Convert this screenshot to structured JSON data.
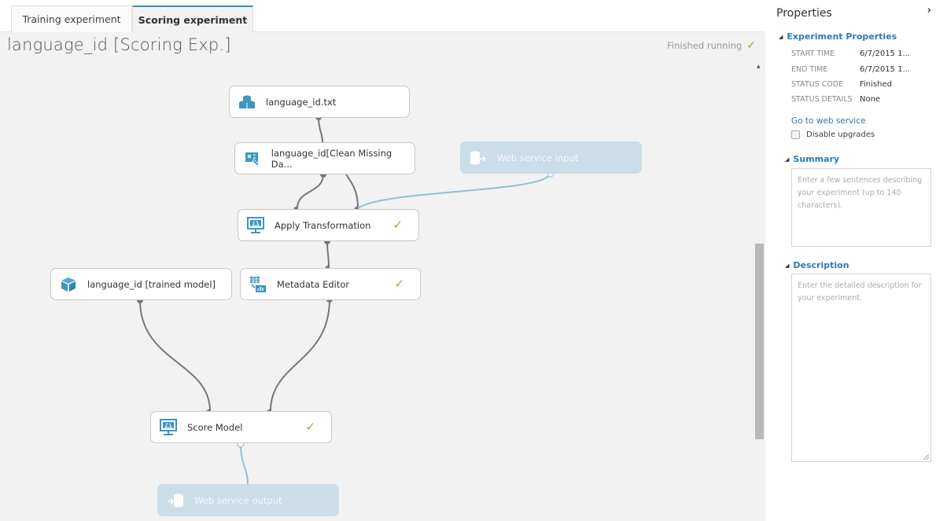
{
  "tabs": [
    {
      "label": "Training experiment",
      "active": false
    },
    {
      "label": "Scoring experiment",
      "active": true
    }
  ],
  "experiment": {
    "title": "language_id [Scoring Exp.]",
    "status_text": "Finished running",
    "status_icon": "check-icon"
  },
  "nodes": {
    "dataset": {
      "label": "language_id.txt",
      "icon": "dataset-icon"
    },
    "clean": {
      "label": "language_id[Clean Missing Da...",
      "icon": "transform-icon"
    },
    "ws_input": {
      "label": "Web service input",
      "icon": "web-service-input-icon"
    },
    "apply": {
      "label": "Apply Transformation",
      "icon": "module-icon",
      "status": "completed"
    },
    "trained_model": {
      "label": "language_id [trained model]",
      "icon": "trained-model-icon"
    },
    "metadata": {
      "label": "Metadata Editor",
      "icon": "metadata-icon",
      "status": "completed"
    },
    "score": {
      "label": "Score Model",
      "icon": "module-icon",
      "status": "completed"
    },
    "ws_output": {
      "label": "Web service output",
      "icon": "web-service-output-icon"
    }
  },
  "properties": {
    "title": "Properties",
    "collapse_icon": "chevron-right-icon",
    "experiment_section": "Experiment Properties",
    "rows": [
      {
        "key": "START TIME",
        "value": "6/7/2015 1..."
      },
      {
        "key": "END TIME",
        "value": "6/7/2015 1..."
      },
      {
        "key": "STATUS CODE",
        "value": "Finished"
      },
      {
        "key": "STATUS DETAILS",
        "value": "None"
      }
    ],
    "web_service_link": "Go to web service",
    "disable_upgrades_label": "Disable upgrades",
    "disable_upgrades_checked": false,
    "summary_section": "Summary",
    "summary_placeholder": "Enter a few sentences describing your experiment (up to 140 characters).",
    "description_section": "Description",
    "description_placeholder": "Enter the detailed description for your experiment."
  },
  "colors": {
    "accent": "#3c8fbd",
    "link": "#2a7bb5",
    "success": "#7cbb37",
    "web_service_node": "#cbdde6",
    "canvas_bg": "#f2f2f2"
  }
}
